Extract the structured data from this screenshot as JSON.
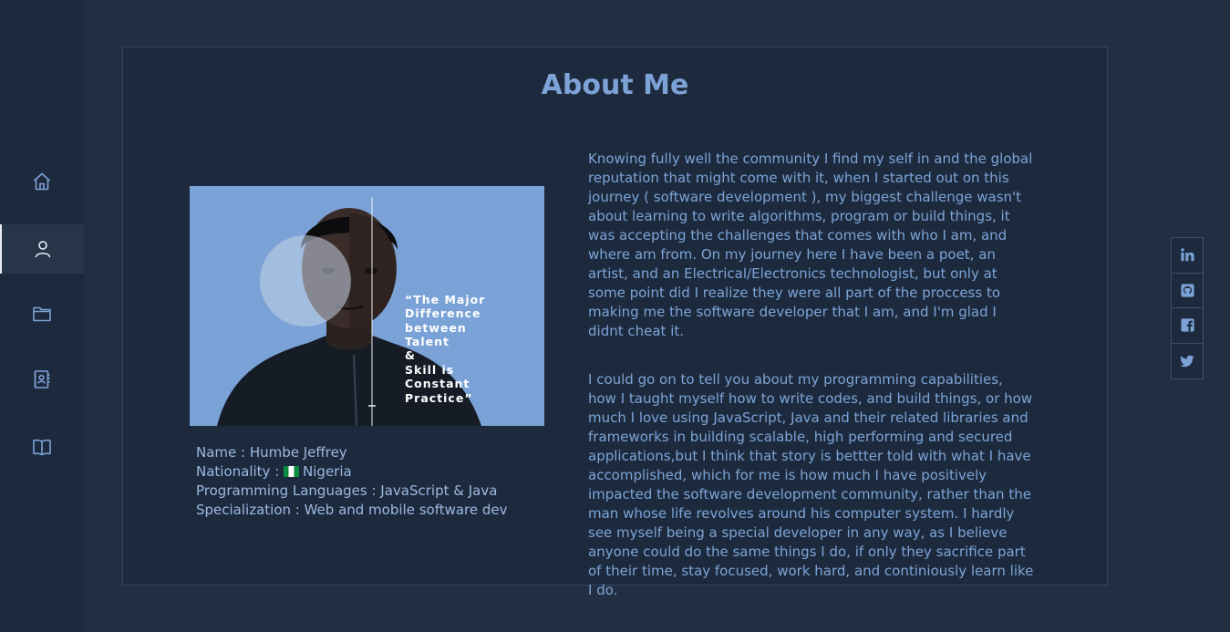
{
  "colors": {
    "background": "#222f42",
    "sidebar": "#1d2a3d",
    "card": "#1d2a3e",
    "accent": "#7da2d6",
    "text": "#7ca4d6"
  },
  "sidebar": {
    "items": [
      {
        "icon": "home-icon",
        "active": false
      },
      {
        "icon": "user-icon",
        "active": true
      },
      {
        "icon": "folder-icon",
        "active": false
      },
      {
        "icon": "contacts-icon",
        "active": false
      },
      {
        "icon": "book-icon",
        "active": false
      }
    ]
  },
  "about": {
    "title": "About Me",
    "image_quote": "“The Major Difference between Talent & Skill is Constant Practice”",
    "image_quote_lines": [
      "“The Major",
      "Difference",
      "between",
      "Talent",
      "&",
      "Skill is",
      "Constant",
      "Practice”"
    ],
    "info": {
      "name": "Name : Humbe Jeffrey",
      "nationality_label": "Nationality : ",
      "nationality_value": "Nigeria",
      "languages": "Programming Languages : JavaScript & Java",
      "specialization": "Specialization : Web and mobile software dev"
    },
    "paragraphs": [
      "Knowing fully well the community I find my self in and the global reputation that might come with it, when I started out on this journey ( software development ), my biggest challenge wasn't about learning to write algorithms, program or build things, it was accepting the challenges that comes with who I am, and where am from. On my journey here I have been a poet, an artist, and an Electrical/Electronics technologist, but only at some point did I realize they were all part of the proccess to making me the software developer that I am, and I'm glad I didnt cheat it.",
      "I could go on to tell you about my programming capabilities, how I taught myself how to write codes, and build things, or how much I love using JavaScript, Java and their related libraries and frameworks in building scalable, high performing and secured applications,but I think that story is bettter told with what I have accomplished, which for me is how much I have positively impacted the software development community, rather than the man whose life revolves around his computer system. I hardly see myself being a special developer in any way, as I believe anyone could do the same things I do, if only they sacrifice part of their time, stay focused, work hard, and continiously learn like I do."
    ]
  },
  "social": [
    {
      "icon": "linkedin-icon"
    },
    {
      "icon": "github-icon"
    },
    {
      "icon": "facebook-icon"
    },
    {
      "icon": "twitter-icon"
    }
  ]
}
